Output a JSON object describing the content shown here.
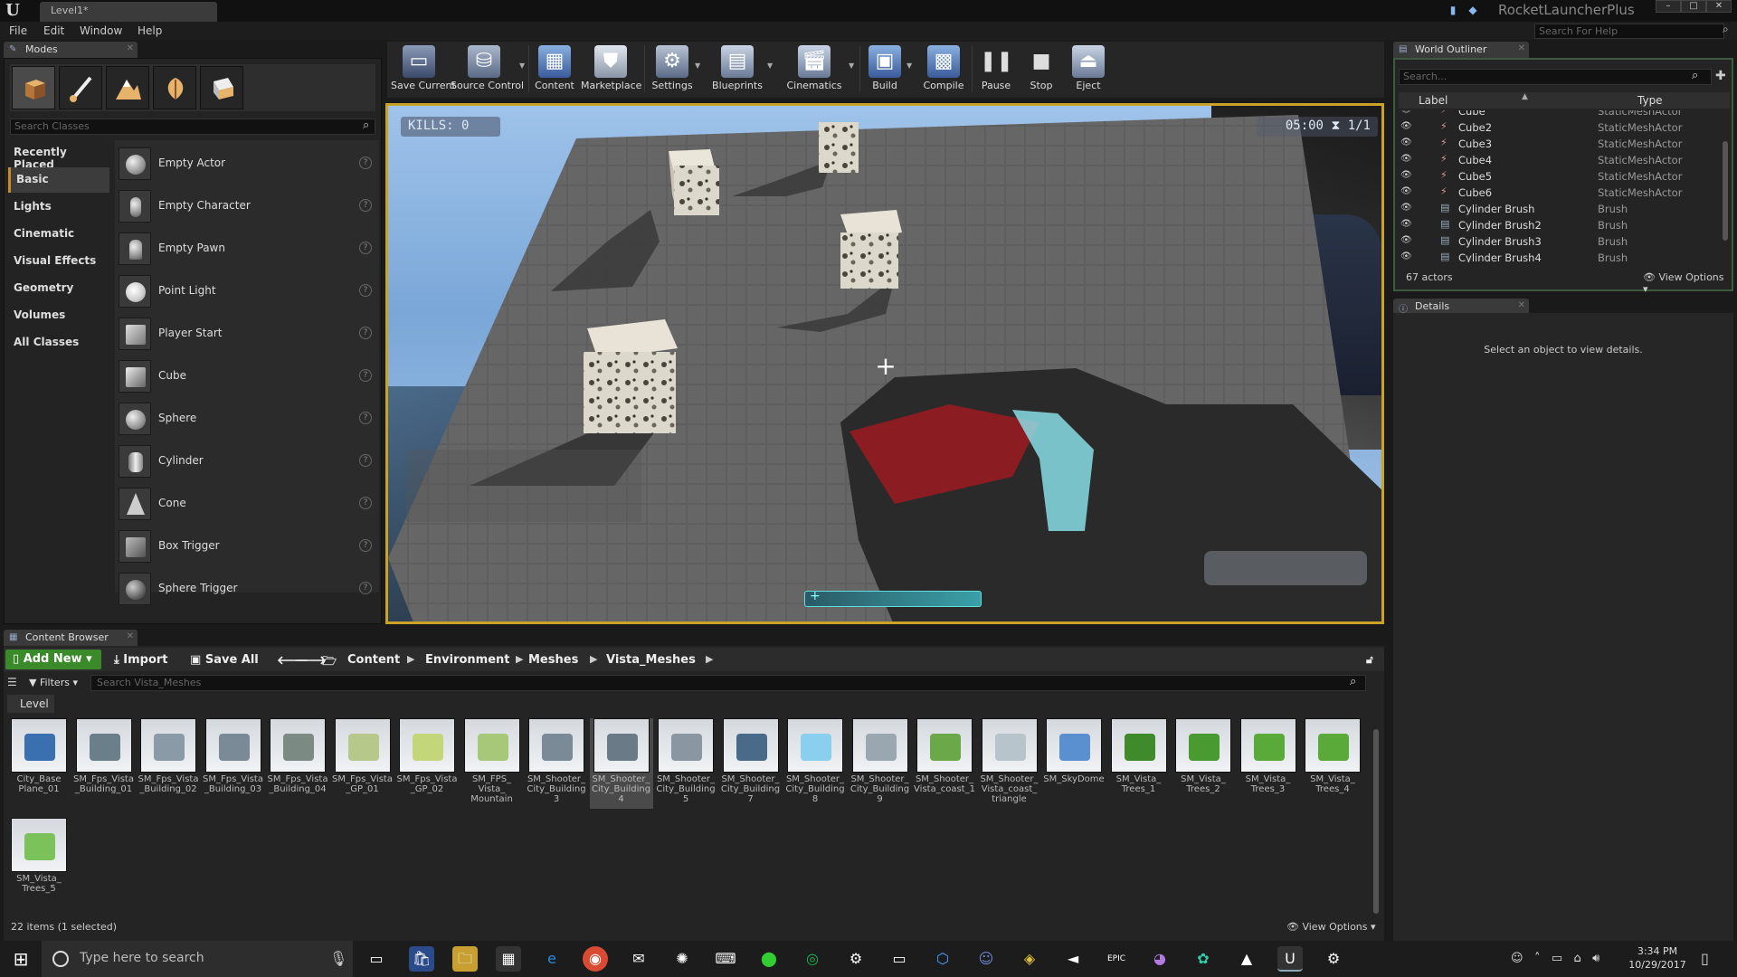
{
  "window": {
    "level_tab": "Level1*",
    "project_name": "RocketLauncherPlus",
    "help_search_placeholder": "Search For Help"
  },
  "menu": [
    "File",
    "Edit",
    "Window",
    "Help"
  ],
  "modes": {
    "tab_label": "Modes",
    "search_placeholder": "Search Classes",
    "categories": [
      "Recently Placed",
      "Basic",
      "Lights",
      "Cinematic",
      "Visual Effects",
      "Geometry",
      "Volumes",
      "All Classes"
    ],
    "active_category": "Basic",
    "classes": [
      "Empty Actor",
      "Empty Character",
      "Empty Pawn",
      "Point Light",
      "Player Start",
      "Cube",
      "Sphere",
      "Cylinder",
      "Cone",
      "Box Trigger",
      "Sphere Trigger"
    ]
  },
  "toolbar": [
    {
      "label": "Save Current",
      "icon": "save-icon",
      "caret": false
    },
    {
      "label": "Source Control",
      "icon": "source-control-icon",
      "caret": true
    },
    {
      "label": "Content",
      "icon": "content-icon",
      "caret": false
    },
    {
      "label": "Marketplace",
      "icon": "marketplace-icon",
      "caret": false
    },
    {
      "label": "Settings",
      "icon": "settings-icon",
      "caret": true
    },
    {
      "label": "Blueprints",
      "icon": "blueprints-icon",
      "caret": true
    },
    {
      "label": "Cinematics",
      "icon": "cinematics-icon",
      "caret": true
    },
    {
      "label": "Build",
      "icon": "build-icon",
      "caret": true
    },
    {
      "label": "Compile",
      "icon": "compile-icon",
      "caret": false
    },
    {
      "label": "Pause",
      "icon": "pause-icon",
      "caret": false
    },
    {
      "label": "Stop",
      "icon": "stop-icon",
      "caret": false
    },
    {
      "label": "Eject",
      "icon": "eject-icon",
      "caret": false
    }
  ],
  "viewport": {
    "kills_label": "KILLS:",
    "kills_value": "0",
    "timer": "05:00",
    "round": "1/1"
  },
  "outliner": {
    "tab_label": "World Outliner",
    "search_placeholder": "Search...",
    "col_label": "Label",
    "col_type": "Type",
    "rows": [
      {
        "label": "Cube",
        "type": "StaticMeshActor",
        "kind": "mesh"
      },
      {
        "label": "Cube2",
        "type": "StaticMeshActor",
        "kind": "mesh"
      },
      {
        "label": "Cube3",
        "type": "StaticMeshActor",
        "kind": "mesh"
      },
      {
        "label": "Cube4",
        "type": "StaticMeshActor",
        "kind": "mesh"
      },
      {
        "label": "Cube5",
        "type": "StaticMeshActor",
        "kind": "mesh"
      },
      {
        "label": "Cube6",
        "type": "StaticMeshActor",
        "kind": "mesh"
      },
      {
        "label": "Cylinder Brush",
        "type": "Brush",
        "kind": "brush"
      },
      {
        "label": "Cylinder Brush2",
        "type": "Brush",
        "kind": "brush"
      },
      {
        "label": "Cylinder Brush3",
        "type": "Brush",
        "kind": "brush"
      },
      {
        "label": "Cylinder Brush4",
        "type": "Brush",
        "kind": "brush"
      }
    ],
    "actor_count": "67 actors",
    "view_options": "View Options"
  },
  "details": {
    "tab_label": "Details",
    "empty_message": "Select an object to view details."
  },
  "content_browser": {
    "tab_label": "Content Browser",
    "add_new": "Add New",
    "import": "Import",
    "save_all": "Save All",
    "breadcrumb": [
      "Content",
      "Environment",
      "Meshes",
      "Vista_Meshes"
    ],
    "filters": "Filters",
    "search_placeholder": "Search Vista_Meshes",
    "level_label": "Level",
    "assets": [
      {
        "name": "City_Base Plane_01",
        "color": "#3a6fb0"
      },
      {
        "name": "SM_Fps_Vista _Building_01",
        "color": "#6a7f8a"
      },
      {
        "name": "SM_Fps_Vista _Building_02",
        "color": "#8a9aa6"
      },
      {
        "name": "SM_Fps_Vista _Building_03",
        "color": "#7a8a96"
      },
      {
        "name": "SM_Fps_Vista _Building_04",
        "color": "#7c8a84"
      },
      {
        "name": "SM_Fps_Vista _GP_01",
        "color": "#b7c98a"
      },
      {
        "name": "SM_Fps_Vista _GP_02",
        "color": "#c4d67a"
      },
      {
        "name": "SM_FPS_ Vista_ Mountain",
        "color": "#a6c878"
      },
      {
        "name": "SM_Shooter_ City_Building 3",
        "color": "#7a8a96"
      },
      {
        "name": "SM_Shooter_ City_Building 4",
        "color": "#6a7a86"
      },
      {
        "name": "SM_Shooter_ City_Building 5",
        "color": "#8a96a2"
      },
      {
        "name": "SM_Shooter_ City_Building 7",
        "color": "#4a6a8a"
      },
      {
        "name": "SM_Shooter_ City_Building 8",
        "color": "#8ad0ee"
      },
      {
        "name": "SM_Shooter_ City_Building 9",
        "color": "#9aa6b0"
      },
      {
        "name": "SM_Shooter_ Vista_coast_1",
        "color": "#6aa84a"
      },
      {
        "name": "SM_Shooter_ Vista_coast_ triangle",
        "color": "#b8c4cc"
      },
      {
        "name": "SM_SkyDome",
        "color": "#5a8fd0"
      },
      {
        "name": "SM_Vista_ Trees_1",
        "color": "#3f8a2a"
      },
      {
        "name": "SM_Vista_ Trees_2",
        "color": "#4a9a32"
      },
      {
        "name": "SM_Vista_ Trees_3",
        "color": "#5aaa3a"
      },
      {
        "name": "SM_Vista_ Trees_4",
        "color": "#5aaa3a"
      },
      {
        "name": "SM_Vista_ Trees_5",
        "color": "#7cc25a"
      }
    ],
    "selected_asset": "SM_Shooter_ City_Building 4",
    "footer": "22 items (1 selected)",
    "view_options": "View Options"
  },
  "taskbar": {
    "search_placeholder": "Type here to search",
    "time": "3:34 PM",
    "date": "10/29/2017"
  }
}
